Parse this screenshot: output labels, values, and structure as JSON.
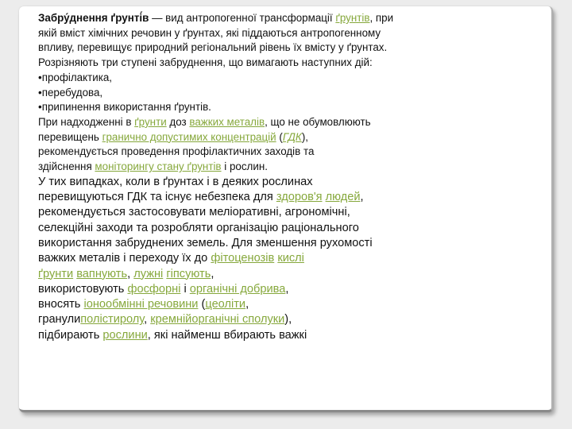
{
  "article": {
    "term": "Забру́днення ґрунті́в",
    "definition": [
      " — вид антропогенної трансформації ",
      "ґрунтів",
      ", при",
      "якій вміст хімічних речовин у ґрунтах, які піддаються антропогенному",
      "впливу, перевищує природний регіональний рівень їх вмісту у ґрунтах.",
      "Розрізняють три ступені забруднення, що вимагають наступних дій:"
    ],
    "bullets": [
      "•профілактика,",
      "•перебудова,",
      "•припинення використання ґрунтів."
    ],
    "para2": [
      "При надходженні в ",
      "ґрунти",
      " доз ",
      "важких металів",
      ", що не обумовлюють",
      "перевищень ",
      "гранично допустимих концентрацій",
      " (",
      "ГДК",
      "),",
      "рекомендується проведення профілактичних заходів та",
      "здійснення ",
      "моніторингу стану ґрунтів",
      " і рослин."
    ],
    "para3": [
      "У тих випадках, коли в ґрунтах і в деяких рослинах",
      "перевищуються ГДК та існує небезпека для ",
      "здоров'я",
      " ",
      "людей",
      ",",
      "рекомендується застосовувати меліоративні, агрономічні,",
      "селекційні заходи та розробляти організацію раціонального",
      "використання забруднених земель. Для зменшення рухомості",
      "важких металів і переходу їх до ",
      "фітоценозів",
      " ",
      "кислі",
      "ґрунти",
      " ",
      "вапнують",
      ", ",
      "лужні",
      " ",
      "гіпсують",
      ",",
      "використовують ",
      "фосфорні",
      " і ",
      "органічні добрива",
      ",",
      "вносять ",
      "іонообмінні речовини",
      " (",
      "цеоліти",
      ",",
      "гранули",
      "полістиролу",
      ", ",
      "кремнійорганічні сполуки",
      "),",
      "підбирають ",
      "рослини",
      ", які найменш вбирають важкі"
    ]
  },
  "colors": {
    "link": "#86a83c",
    "text": "#111111",
    "page": "#ececec",
    "sheet": "#ffffff"
  }
}
